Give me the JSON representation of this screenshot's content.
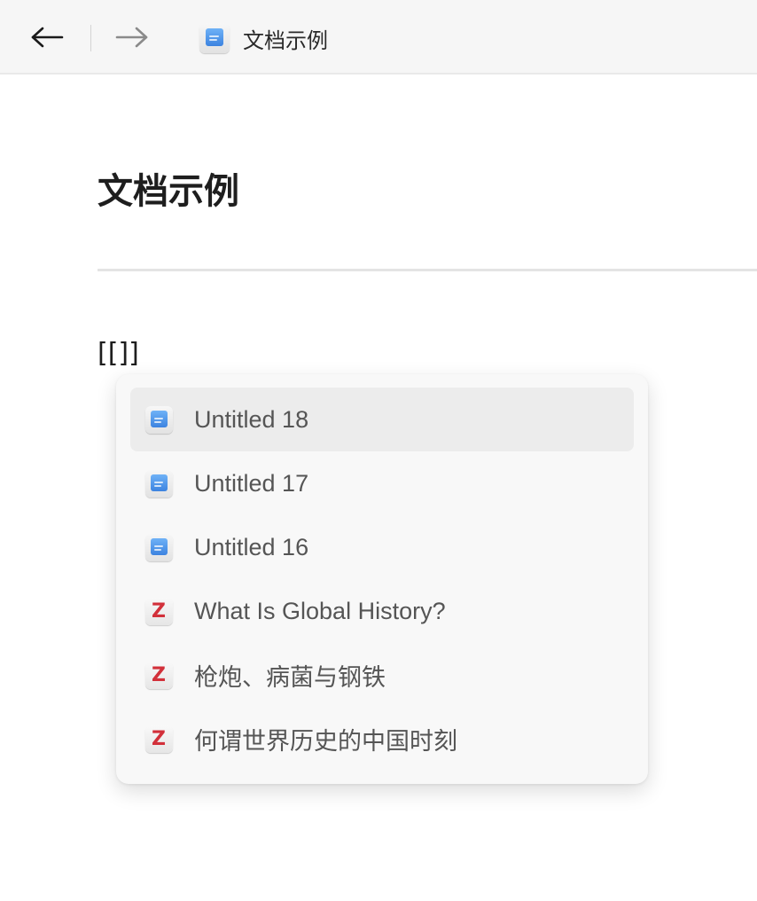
{
  "toolbar": {
    "back_icon": "arrow-left-icon",
    "forward_icon": "arrow-right-icon",
    "doc_icon": "document-icon",
    "title": "文档示例"
  },
  "page": {
    "title": "文档示例",
    "editor_text": "[[]]"
  },
  "suggestions": [
    {
      "label": "Untitled 18",
      "icon": "document-icon",
      "selected": true
    },
    {
      "label": "Untitled 17",
      "icon": "document-icon",
      "selected": false
    },
    {
      "label": "Untitled 16",
      "icon": "document-icon",
      "selected": false
    },
    {
      "label": "What Is Global History?",
      "icon": "zotero-icon",
      "icon_letter": "Z",
      "selected": false
    },
    {
      "label": "枪炮、病菌与钢铁",
      "icon": "zotero-icon",
      "icon_letter": "Z",
      "selected": false
    },
    {
      "label": "何谓世界历史的中国时刻",
      "icon": "zotero-icon",
      "icon_letter": "Z",
      "selected": false
    }
  ],
  "colors": {
    "doc_icon_blue": "#3c83e0",
    "zotero_red": "#d2303a",
    "selected_row": "#ececec"
  }
}
